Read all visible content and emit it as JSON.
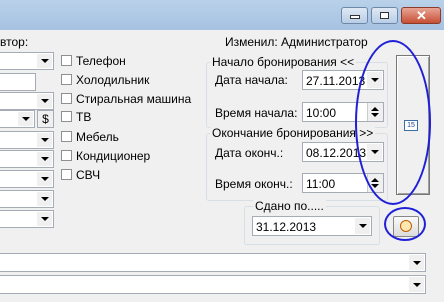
{
  "window": {
    "minimize_icon": "minimize-icon",
    "maximize_icon": "maximize-icon",
    "close_icon": "close-icon"
  },
  "left": {
    "header_partial": "втор:",
    "currency_button": "$"
  },
  "amenities": [
    {
      "label": "Телефон",
      "checked": false
    },
    {
      "label": "Холодильник",
      "checked": false
    },
    {
      "label": "Стиральная машина",
      "checked": false
    },
    {
      "label": "ТВ",
      "checked": false
    },
    {
      "label": "Мебель",
      "checked": false
    },
    {
      "label": "Кондиционер",
      "checked": false
    },
    {
      "label": "СВЧ",
      "checked": false
    }
  ],
  "modified_by": "Изменил: Администратор",
  "booking_start": {
    "legend": "Начало бронирования <<",
    "date_label": "Дата начала:",
    "date_value": "27.11.2013",
    "time_label": "Время начала:",
    "time_value": "10:00"
  },
  "booking_end": {
    "legend": "Окончание бронирования >>",
    "date_label": "Дата оконч.:",
    "date_value": "08.12.2013",
    "time_label": "Время оконч.:",
    "time_value": "11:00"
  },
  "handed_over": {
    "legend": "Сдано по.....",
    "date_value": "31.12.2013"
  },
  "colors": {
    "annotation": "#1f1fd8",
    "titlebar": "#b9d1ea",
    "window_bg": "#f0f0f0"
  }
}
